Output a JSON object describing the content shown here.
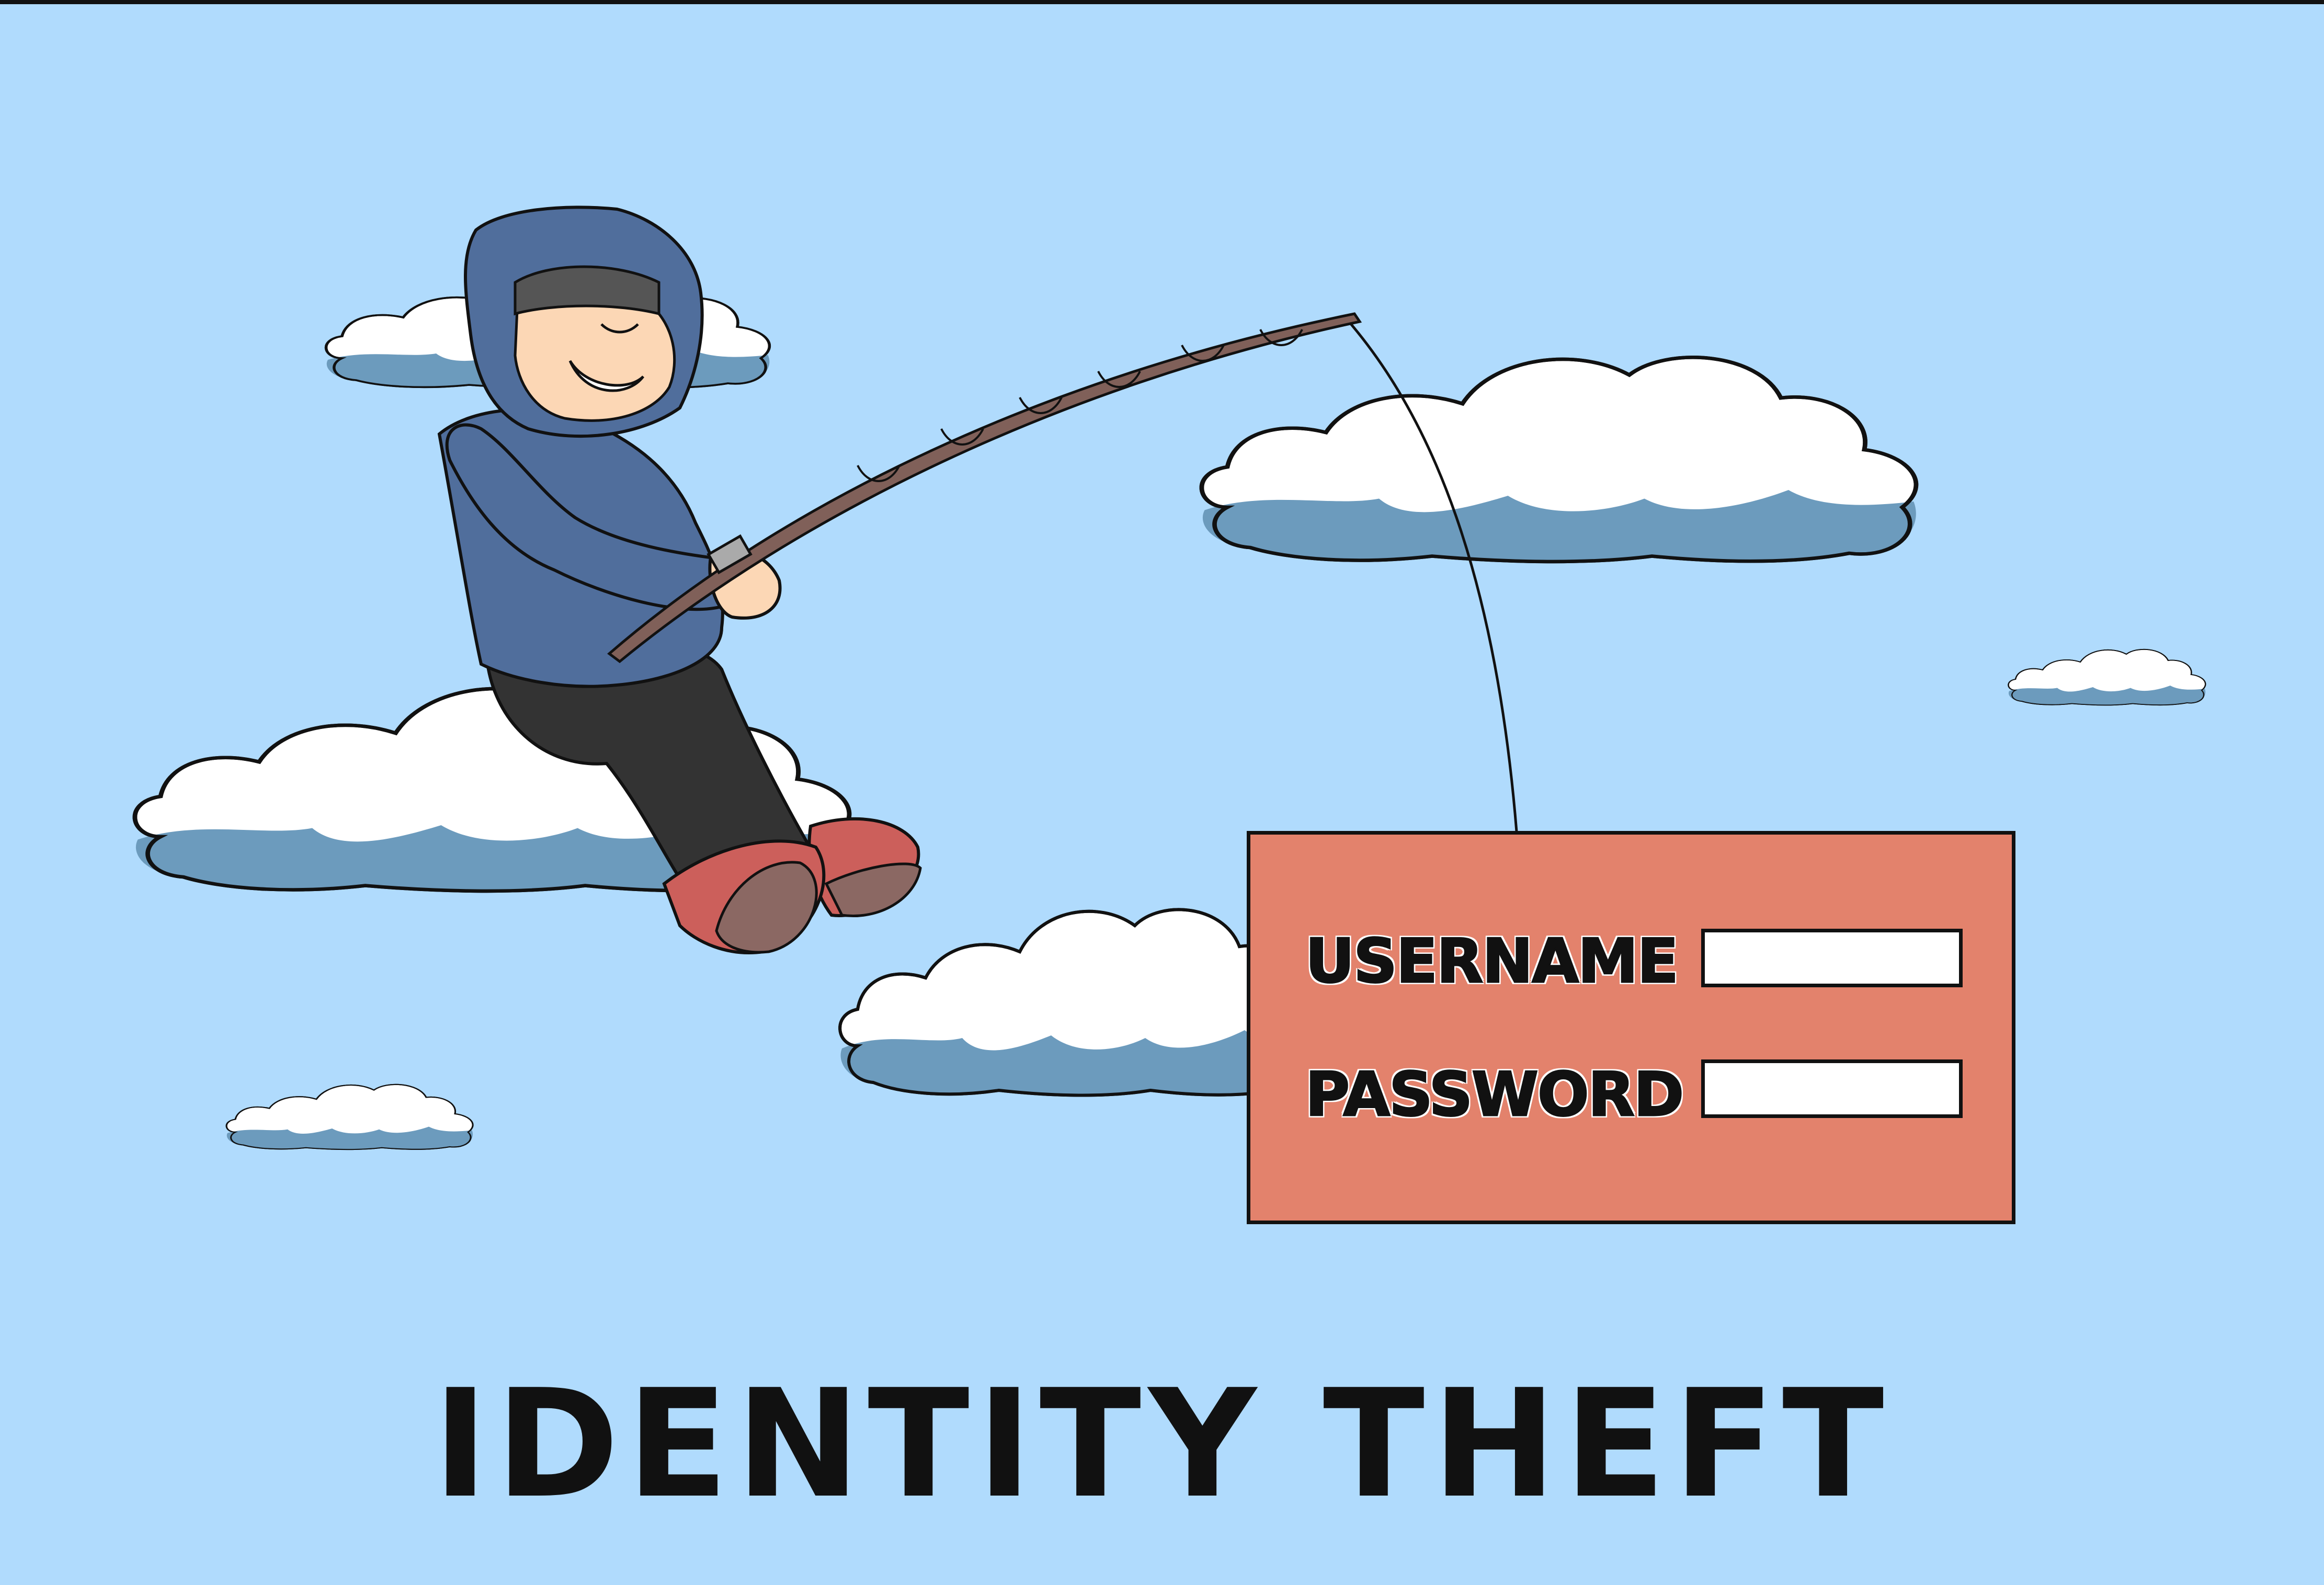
{
  "login": {
    "username_label": "USERNAME",
    "password_label": "PASSWORD",
    "username_value": "",
    "password_value": ""
  },
  "caption": "IDENTITY THEFT",
  "colors": {
    "sky": "#b0dbfd",
    "cloud_top": "#ffffff",
    "cloud_shade": "#6c9bbd",
    "hoodie": "#506e9c",
    "pants": "#333333",
    "shoes": "#cc5f5b",
    "rod": "#806059",
    "panel": "#e3826c"
  },
  "icons": [
    "hacker-figure",
    "fishing-rod",
    "fishing-line",
    "cloud"
  ]
}
